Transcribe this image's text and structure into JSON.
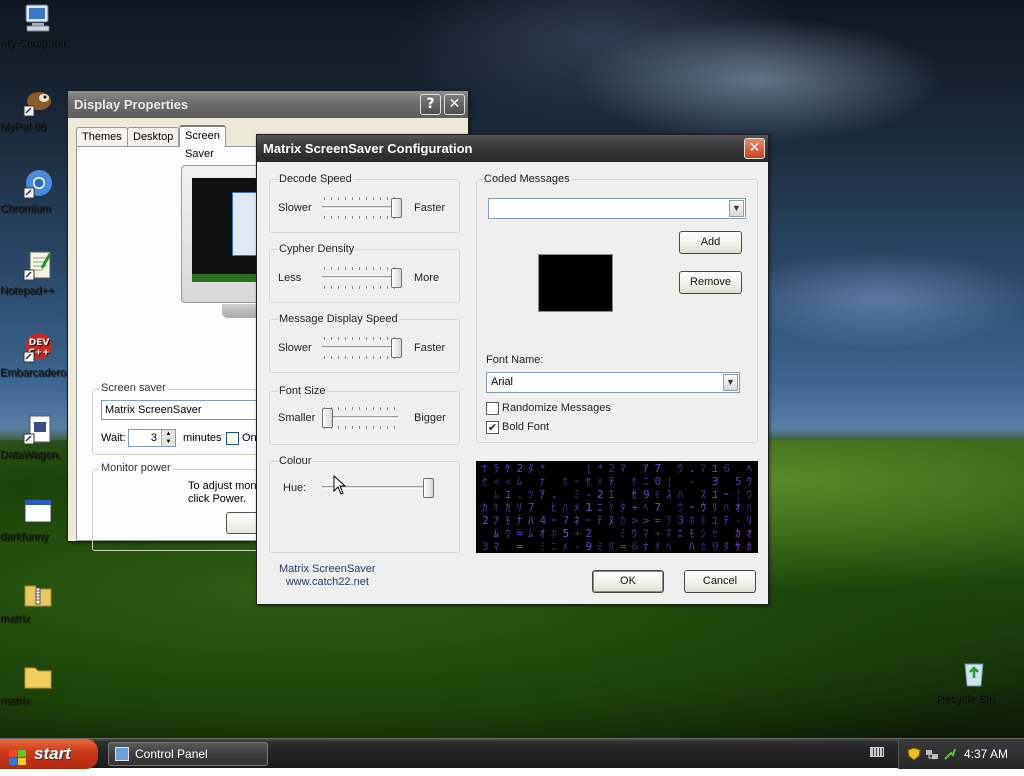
{
  "desktop": {
    "icons": [
      {
        "label": "My Computer"
      },
      {
        "label": "MyPal 68"
      },
      {
        "label": "Chromium"
      },
      {
        "label": "Notepad++"
      },
      {
        "label": "Embarcadero Dev-C++"
      },
      {
        "label": "DataWagon."
      },
      {
        "label": "darkfunny"
      },
      {
        "label": "matrix"
      },
      {
        "label": "matrix"
      },
      {
        "label": "Recycle Bin"
      }
    ]
  },
  "taskbar": {
    "start_label": "start",
    "task_label": "Control Panel",
    "clock": "4:37 AM"
  },
  "display_properties": {
    "title": "Display Properties",
    "help_btn": "?",
    "close_btn": "✕",
    "tabs": [
      "Themes",
      "Desktop",
      "Screen Saver"
    ],
    "screen_saver_group": "Screen saver",
    "screen_saver_value": "Matrix ScreenSaver",
    "wait_label": "Wait:",
    "wait_value": "3",
    "minutes_label": "minutes",
    "on_resume_label": "On",
    "monitor_power_group": "Monitor power",
    "monitor_power_text_1": "To adjust mon",
    "monitor_power_text_2": "click Power."
  },
  "matrix_config": {
    "title": "Matrix ScreenSaver Configuration",
    "close_btn": "✕",
    "decode_speed": {
      "title": "Decode Speed",
      "min_label": "Slower",
      "max_label": "Faster",
      "level": 1.0
    },
    "cypher_density": {
      "title": "Cypher Density",
      "min_label": "Less",
      "max_label": "More",
      "level": 1.0
    },
    "message_speed": {
      "title": "Message Display Speed",
      "min_label": "Slower",
      "max_label": "Faster",
      "level": 1.0
    },
    "font_size": {
      "title": "Font Size",
      "min_label": "Smaller",
      "max_label": "Bigger",
      "level": 0.0
    },
    "colour": {
      "title": "Colour",
      "hue_label": "Hue:",
      "level": 1.0
    },
    "coded_messages": {
      "title": "Coded Messages",
      "value": "",
      "add_button": "Add",
      "remove_button": "Remove",
      "swatch_color": "#000000"
    },
    "font_name_label": "Font Name:",
    "font_name_value": "Arial",
    "randomize_label": "Randomize Messages",
    "randomize_checked": false,
    "bold_label": "Bold Font",
    "bold_checked": true,
    "about_line1": "Matrix ScreenSaver",
    "about_line2": "www.catch22.net",
    "ok_button": "OK",
    "cancel_button": "Cancel",
    "preview_glyph_color": "#7a52e0"
  }
}
